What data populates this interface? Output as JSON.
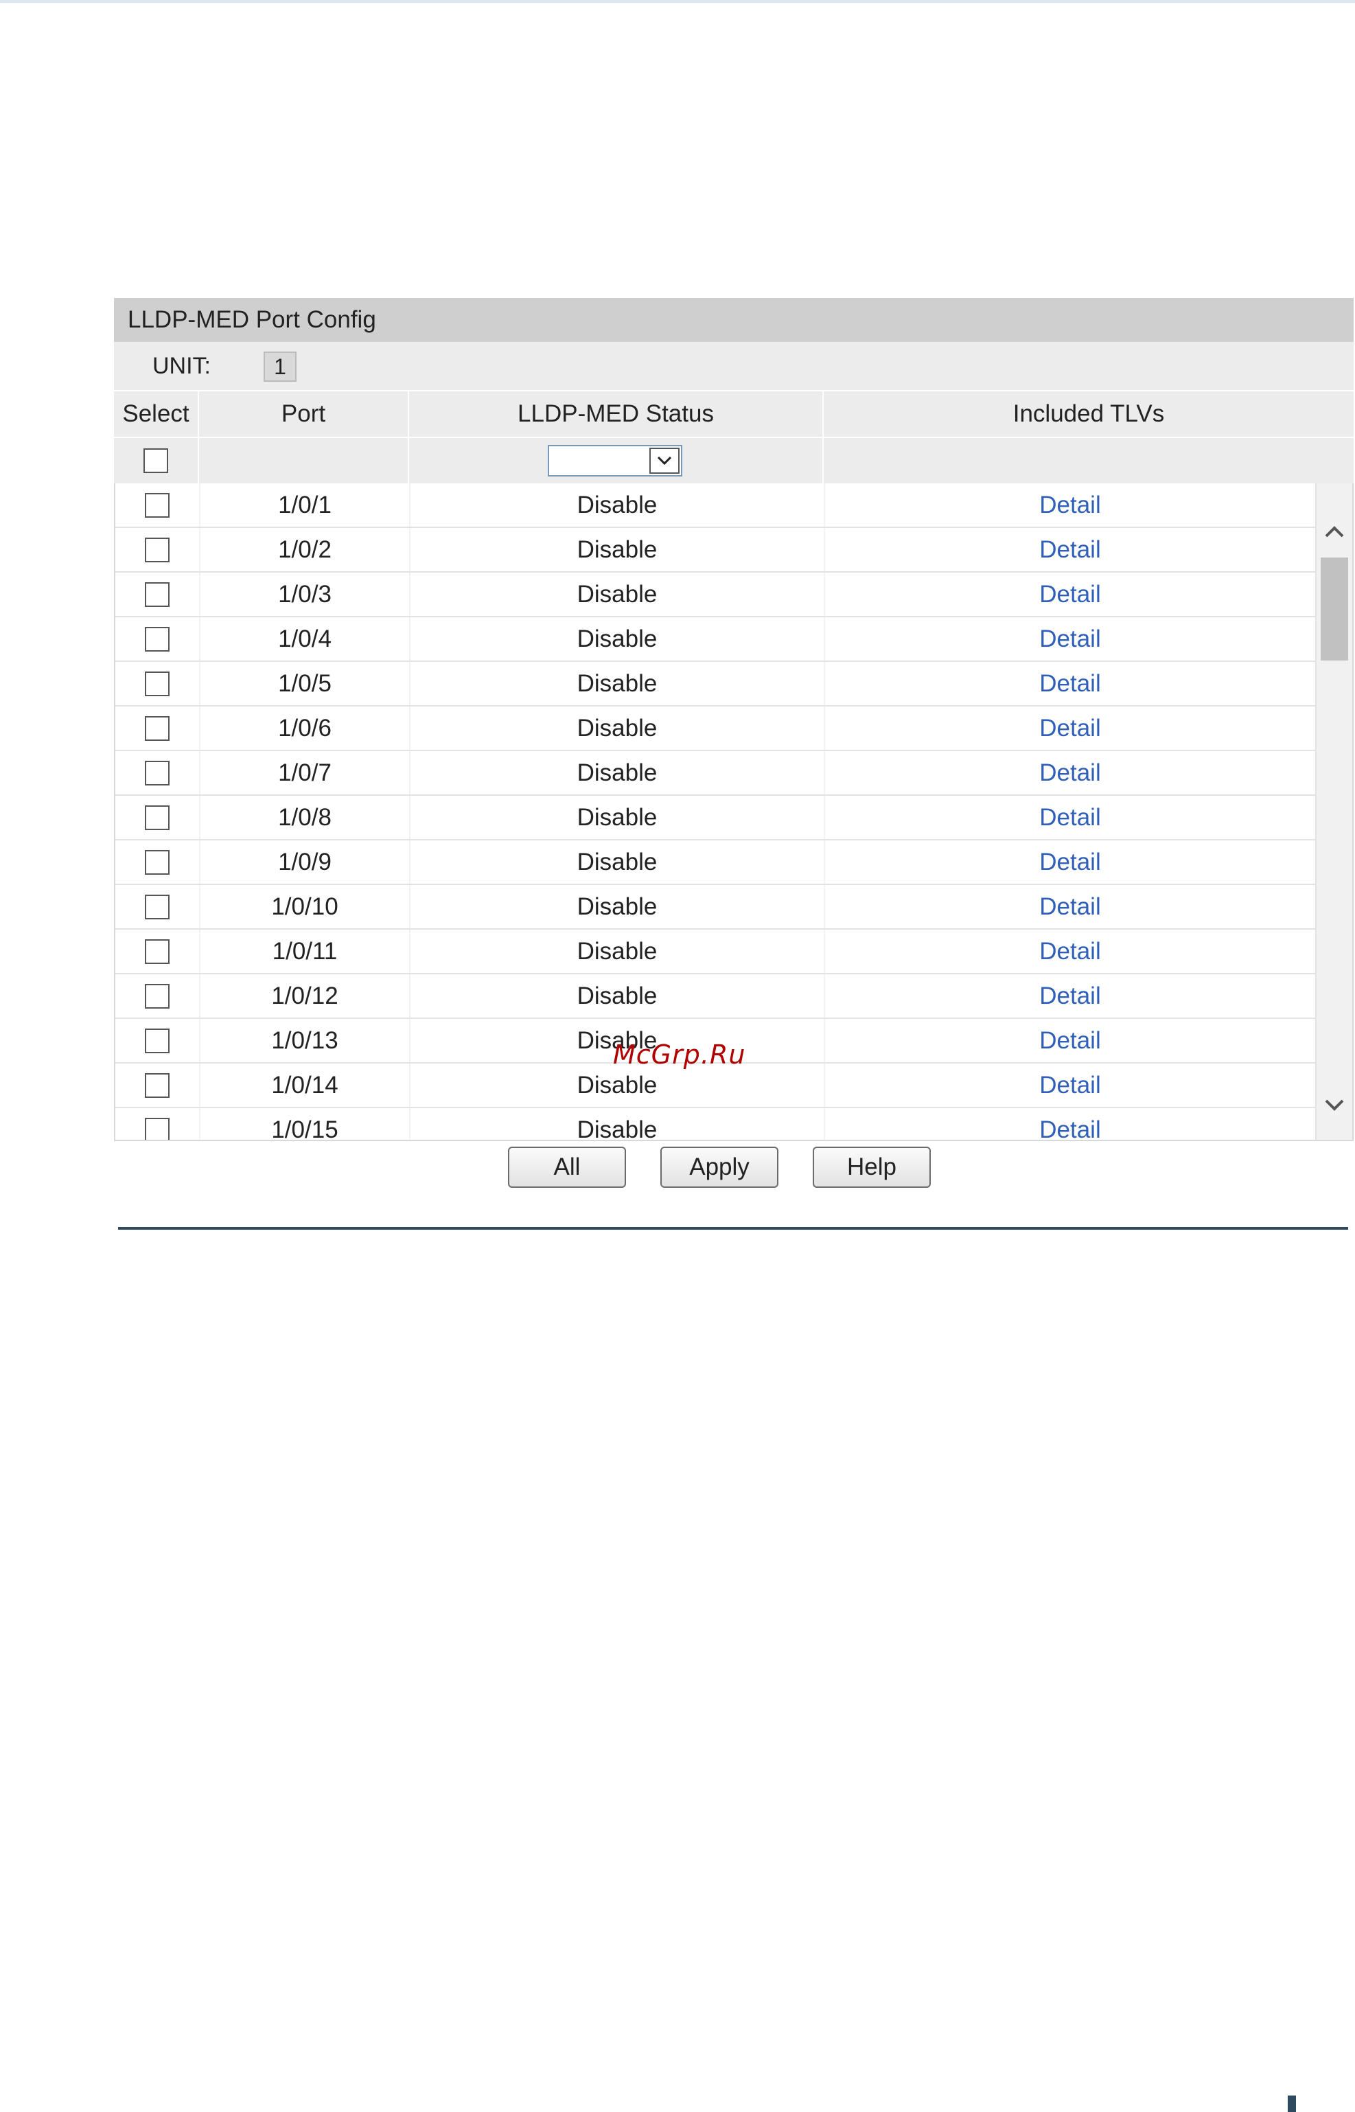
{
  "panel": {
    "title": "LLDP-MED Port Config",
    "unit_label": "UNIT:",
    "unit_value": "1"
  },
  "table": {
    "headers": {
      "select": "Select",
      "port": "Port",
      "status": "LLDP-MED Status",
      "tlvs": "Included TLVs"
    },
    "filter_status_value": "",
    "rows": [
      {
        "port": "1/0/1",
        "status": "Disable",
        "tlvs": "Detail"
      },
      {
        "port": "1/0/2",
        "status": "Disable",
        "tlvs": "Detail"
      },
      {
        "port": "1/0/3",
        "status": "Disable",
        "tlvs": "Detail"
      },
      {
        "port": "1/0/4",
        "status": "Disable",
        "tlvs": "Detail"
      },
      {
        "port": "1/0/5",
        "status": "Disable",
        "tlvs": "Detail"
      },
      {
        "port": "1/0/6",
        "status": "Disable",
        "tlvs": "Detail"
      },
      {
        "port": "1/0/7",
        "status": "Disable",
        "tlvs": "Detail"
      },
      {
        "port": "1/0/8",
        "status": "Disable",
        "tlvs": "Detail"
      },
      {
        "port": "1/0/9",
        "status": "Disable",
        "tlvs": "Detail"
      },
      {
        "port": "1/0/10",
        "status": "Disable",
        "tlvs": "Detail"
      },
      {
        "port": "1/0/11",
        "status": "Disable",
        "tlvs": "Detail"
      },
      {
        "port": "1/0/12",
        "status": "Disable",
        "tlvs": "Detail"
      },
      {
        "port": "1/0/13",
        "status": "Disable",
        "tlvs": "Detail"
      },
      {
        "port": "1/0/14",
        "status": "Disable",
        "tlvs": "Detail"
      },
      {
        "port": "1/0/15",
        "status": "Disable",
        "tlvs": "Detail"
      }
    ]
  },
  "buttons": {
    "all": "All",
    "apply": "Apply",
    "help": "Help"
  },
  "watermark": "McGrp.Ru",
  "colors": {
    "title_bar": "#cfcfcf",
    "header_bg": "#ececec",
    "link": "#2f5fb8",
    "rule": "#2e4a5e",
    "watermark": "#b00000"
  }
}
